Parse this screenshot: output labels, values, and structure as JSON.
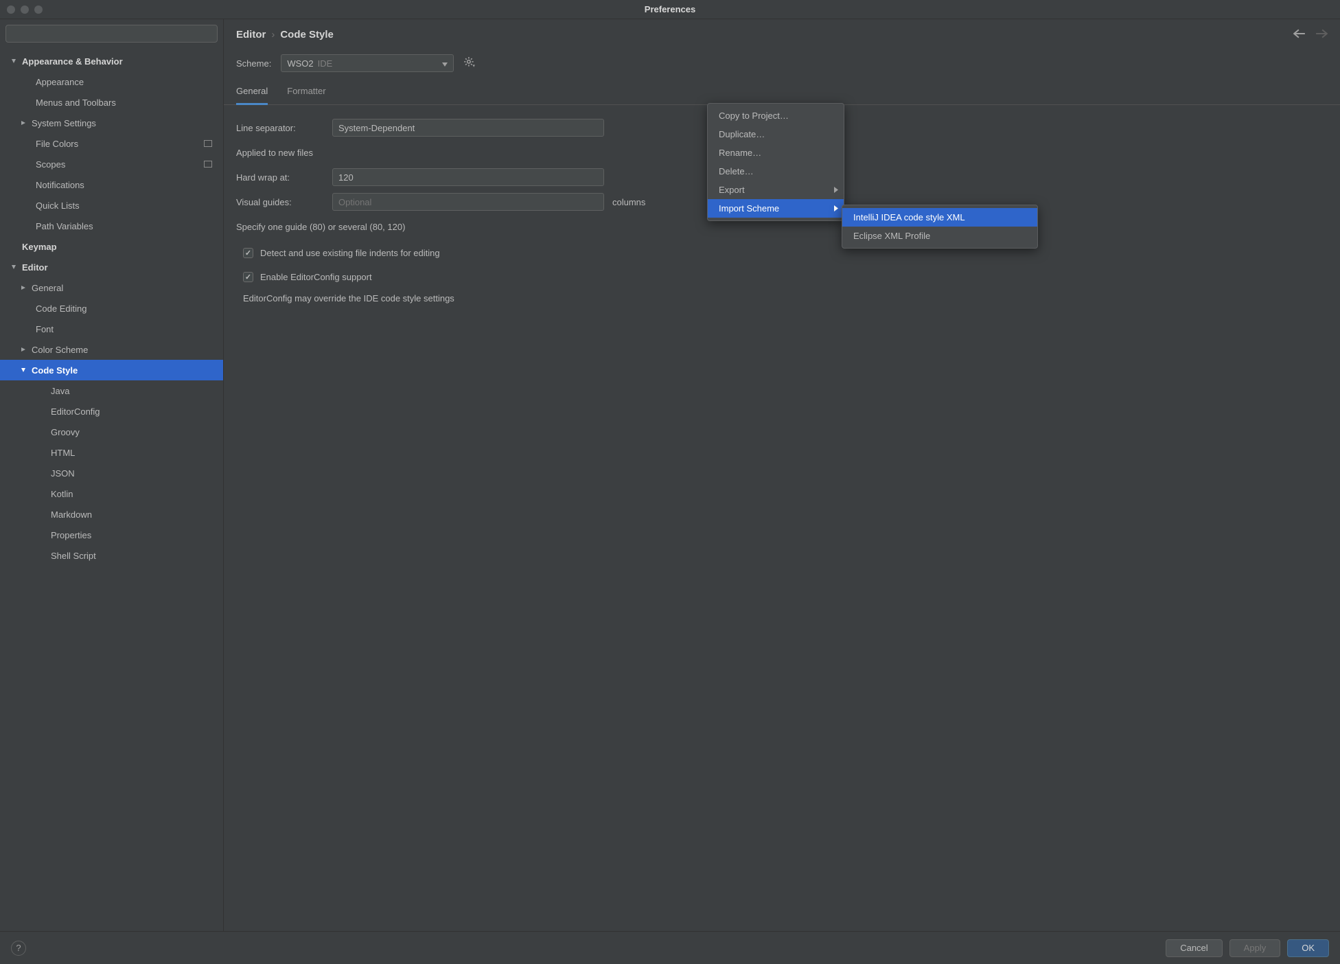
{
  "window": {
    "title": "Preferences"
  },
  "sidebar": {
    "items": [
      {
        "label": "Appearance & Behavior"
      },
      {
        "label": "Appearance"
      },
      {
        "label": "Menus and Toolbars"
      },
      {
        "label": "System Settings"
      },
      {
        "label": "File Colors"
      },
      {
        "label": "Scopes"
      },
      {
        "label": "Notifications"
      },
      {
        "label": "Quick Lists"
      },
      {
        "label": "Path Variables"
      },
      {
        "label": "Keymap"
      },
      {
        "label": "Editor"
      },
      {
        "label": "General"
      },
      {
        "label": "Code Editing"
      },
      {
        "label": "Font"
      },
      {
        "label": "Color Scheme"
      },
      {
        "label": "Code Style"
      },
      {
        "label": "Java"
      },
      {
        "label": "EditorConfig"
      },
      {
        "label": "Groovy"
      },
      {
        "label": "HTML"
      },
      {
        "label": "JSON"
      },
      {
        "label": "Kotlin"
      },
      {
        "label": "Markdown"
      },
      {
        "label": "Properties"
      },
      {
        "label": "Shell Script"
      }
    ]
  },
  "breadcrumb": {
    "a": "Editor",
    "b": "Code Style"
  },
  "scheme": {
    "label": "Scheme:",
    "value": "WSO2",
    "scope": "IDE"
  },
  "tabs": {
    "general": "General",
    "formatter": "Formatter"
  },
  "form": {
    "line_sep_label": "Line separator:",
    "line_sep_value": "System-Dependent",
    "line_sep_hint": "Applied to new files",
    "hard_wrap_label": "Hard wrap at:",
    "hard_wrap_value": "120",
    "visual_guides_label": "Visual guides:",
    "visual_guides_placeholder": "Optional",
    "visual_guides_after": "columns",
    "visual_guides_hint": "Specify one guide (80) or several (80, 120)",
    "detect_label": "Detect and use existing file indents for editing",
    "editorconfig_label": "Enable EditorConfig support",
    "editorconfig_hint": "EditorConfig may override the IDE code style settings"
  },
  "popup": {
    "copy": "Copy to Project…",
    "duplicate": "Duplicate…",
    "rename": "Rename…",
    "delete": "Delete…",
    "export": "Export",
    "import": "Import Scheme",
    "sub_intellij": "IntelliJ IDEA code style XML",
    "sub_eclipse": "Eclipse XML Profile"
  },
  "footer": {
    "cancel": "Cancel",
    "apply": "Apply",
    "ok": "OK"
  }
}
